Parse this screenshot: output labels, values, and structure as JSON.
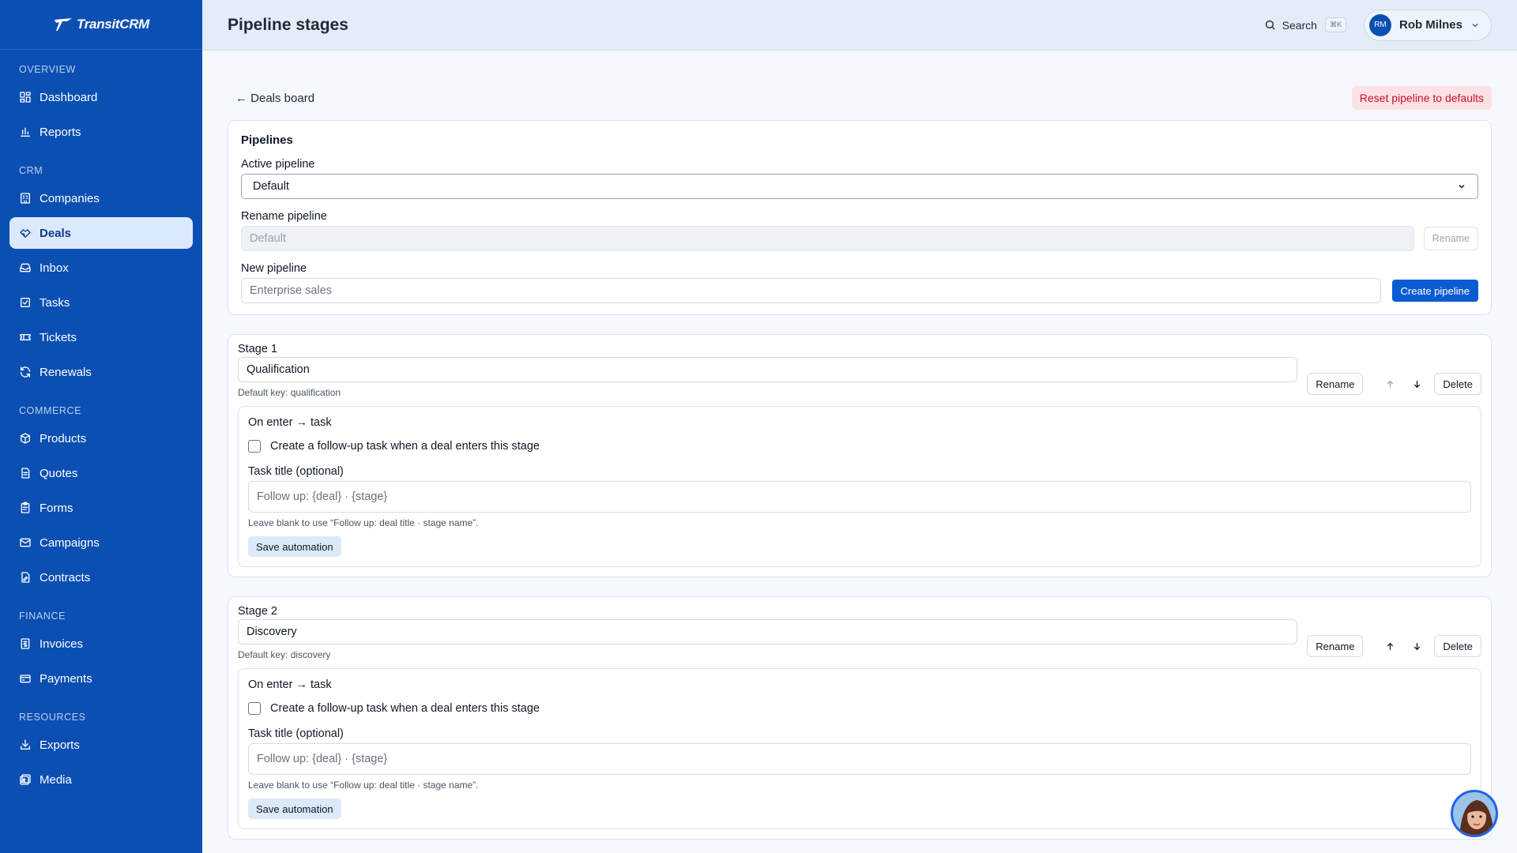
{
  "brand": {
    "name": "TransitCRM"
  },
  "sidebar": {
    "sections": [
      {
        "heading": "OVERVIEW",
        "items": [
          {
            "label": "Dashboard",
            "icon": "dashboard-icon"
          },
          {
            "label": "Reports",
            "icon": "reports-icon"
          }
        ]
      },
      {
        "heading": "CRM",
        "items": [
          {
            "label": "Companies",
            "icon": "companies-icon"
          },
          {
            "label": "Deals",
            "icon": "deals-icon",
            "active": true
          },
          {
            "label": "Inbox",
            "icon": "inbox-icon"
          },
          {
            "label": "Tasks",
            "icon": "tasks-icon"
          },
          {
            "label": "Tickets",
            "icon": "tickets-icon"
          },
          {
            "label": "Renewals",
            "icon": "renewals-icon"
          }
        ]
      },
      {
        "heading": "COMMERCE",
        "items": [
          {
            "label": "Products",
            "icon": "products-icon"
          },
          {
            "label": "Quotes",
            "icon": "quotes-icon"
          },
          {
            "label": "Forms",
            "icon": "forms-icon"
          },
          {
            "label": "Campaigns",
            "icon": "campaigns-icon"
          },
          {
            "label": "Contracts",
            "icon": "contracts-icon"
          }
        ]
      },
      {
        "heading": "FINANCE",
        "items": [
          {
            "label": "Invoices",
            "icon": "invoices-icon"
          },
          {
            "label": "Payments",
            "icon": "payments-icon"
          }
        ]
      },
      {
        "heading": "RESOURCES",
        "items": [
          {
            "label": "Exports",
            "icon": "exports-icon"
          },
          {
            "label": "Media",
            "icon": "media-icon"
          }
        ]
      }
    ]
  },
  "header": {
    "title": "Pipeline stages",
    "search_label": "Search",
    "search_shortcut": "⌘K",
    "user_initials": "RM",
    "user_name": "Rob Milnes"
  },
  "toolbar": {
    "back_label": "← Deals board",
    "reset_label": "Reset pipeline to defaults"
  },
  "pipelines": {
    "title": "Pipelines",
    "active_label": "Active pipeline",
    "active_value": "Default",
    "rename_label": "Rename pipeline",
    "rename_value": "Default",
    "rename_button": "Rename",
    "new_label": "New pipeline",
    "new_placeholder": "Enterprise sales",
    "create_button": "Create pipeline"
  },
  "stages": [
    {
      "label": "Stage 1",
      "name": "Qualification",
      "default_key": "Default key: qualification",
      "rename": "Rename",
      "delete": "Delete",
      "up_disabled": true,
      "automation_title": "On enter → task",
      "checkbox_label": "Create a follow-up task when a deal enters this stage",
      "task_title_label": "Task title (optional)",
      "task_title_placeholder": "Follow up: {deal} · {stage}",
      "hint": "Leave blank to use “Follow up: deal title · stage name”.",
      "save": "Save automation"
    },
    {
      "label": "Stage 2",
      "name": "Discovery",
      "default_key": "Default key: discovery",
      "rename": "Rename",
      "delete": "Delete",
      "up_disabled": false,
      "automation_title": "On enter → task",
      "checkbox_label": "Create a follow-up task when a deal enters this stage",
      "task_title_label": "Task title (optional)",
      "task_title_placeholder": "Follow up: {deal} · {stage}",
      "hint": "Leave blank to use “Follow up: deal title · stage name”.",
      "save": "Save automation"
    }
  ],
  "colors": {
    "sidebar": "#0b4fb3",
    "primary": "#0b5bd3",
    "danger": "#c8102e"
  }
}
